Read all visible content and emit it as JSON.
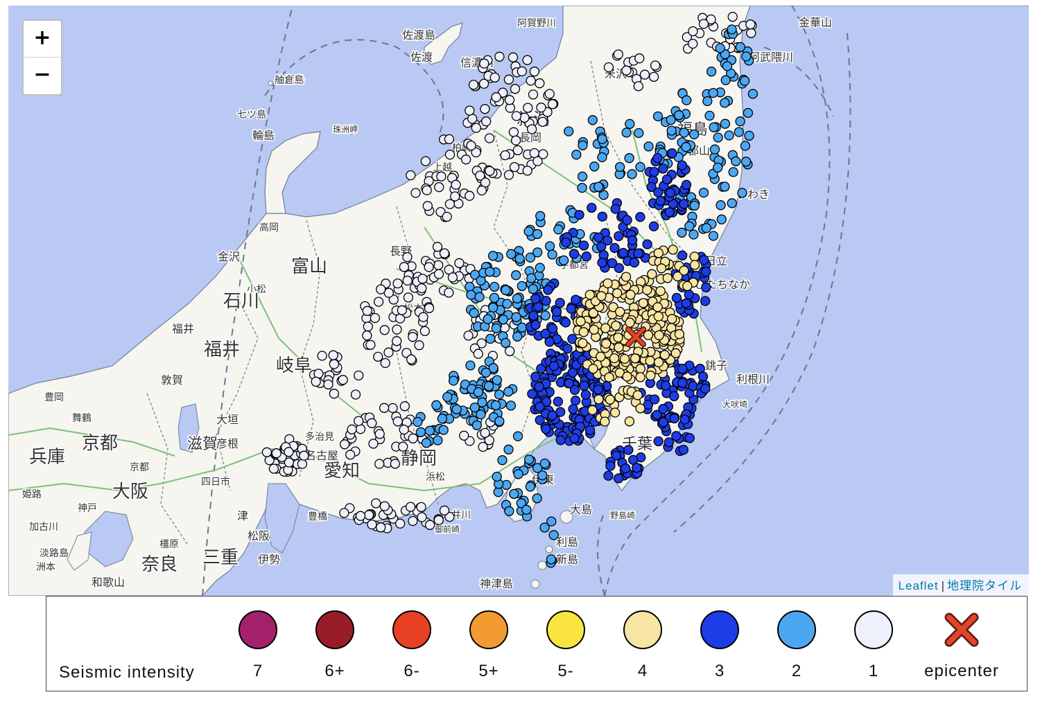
{
  "map": {
    "zoom_in_label": "+",
    "zoom_out_label": "−",
    "attribution": {
      "leaflet": "Leaflet",
      "separator": "|",
      "tiles": "地理院タイル"
    },
    "colors": {
      "sea": "#b9c9f3",
      "land": "#f6f5ef",
      "coast": "#6f7f9a",
      "border": "#8a8a8a",
      "road": "#7cc07c"
    },
    "place_labels": [
      {
        "text": "佐渡島",
        "size": 16
      },
      {
        "text": "佐渡",
        "size": 16
      },
      {
        "text": "粟島",
        "size": 14
      },
      {
        "text": "新潟",
        "size": 24
      },
      {
        "text": "長岡",
        "size": 16
      },
      {
        "text": "柏崎",
        "size": 14
      },
      {
        "text": "上越",
        "size": 14
      },
      {
        "text": "輪島",
        "size": 16
      },
      {
        "text": "舳倉島",
        "size": 14
      },
      {
        "text": "七ツ島",
        "size": 14
      },
      {
        "text": "珠洲岬",
        "size": 12
      },
      {
        "text": "高岡",
        "size": 14
      },
      {
        "text": "金沢",
        "size": 16
      },
      {
        "text": "富山",
        "size": 26
      },
      {
        "text": "小松",
        "size": 14
      },
      {
        "text": "石川",
        "size": 26
      },
      {
        "text": "福井",
        "size": 16
      },
      {
        "text": "福井",
        "size": 26
      },
      {
        "text": "岐阜",
        "size": 26
      },
      {
        "text": "敦賀",
        "size": 16
      },
      {
        "text": "豊岡",
        "size": 14
      },
      {
        "text": "舞鶴",
        "size": 14
      },
      {
        "text": "京都",
        "size": 26
      },
      {
        "text": "兵庫",
        "size": 26
      },
      {
        "text": "大阪",
        "size": 26
      },
      {
        "text": "奈良",
        "size": 26
      },
      {
        "text": "滋賀",
        "size": 22
      },
      {
        "text": "三重",
        "size": 26
      },
      {
        "text": "愛知",
        "size": 26
      },
      {
        "text": "静岡",
        "size": 26
      },
      {
        "text": "長野",
        "size": 16
      },
      {
        "text": "松本",
        "size": 14
      },
      {
        "text": "大垣",
        "size": 16
      },
      {
        "text": "彦根",
        "size": 16
      },
      {
        "text": "多治見",
        "size": 14
      },
      {
        "text": "名古屋",
        "size": 16
      },
      {
        "text": "四日市",
        "size": 14
      },
      {
        "text": "津",
        "size": 16
      },
      {
        "text": "松阪",
        "size": 16
      },
      {
        "text": "伊勢",
        "size": 16
      },
      {
        "text": "豊橋",
        "size": 14
      },
      {
        "text": "浜松",
        "size": 14
      },
      {
        "text": "伊東",
        "size": 16
      },
      {
        "text": "大島",
        "size": 16
      },
      {
        "text": "利島",
        "size": 16
      },
      {
        "text": "新島",
        "size": 16
      },
      {
        "text": "神津島",
        "size": 16
      },
      {
        "text": "御前崎",
        "size": 12
      },
      {
        "text": "横須賀",
        "size": 16
      },
      {
        "text": "千葉",
        "size": 22
      },
      {
        "text": "銚子",
        "size": 16
      },
      {
        "text": "日立",
        "size": 16
      },
      {
        "text": "ひたちなか",
        "size": 16
      },
      {
        "text": "いわき",
        "size": 16
      },
      {
        "text": "福島",
        "size": 22
      },
      {
        "text": "郡山",
        "size": 16
      },
      {
        "text": "米沢",
        "size": 16
      },
      {
        "text": "宇都宮",
        "size": 14
      },
      {
        "text": "金華山",
        "size": 16
      },
      {
        "text": "阿武隈川",
        "size": 16
      },
      {
        "text": "信濃川",
        "size": 16
      },
      {
        "text": "阿賀野川",
        "size": 14
      },
      {
        "text": "利根川",
        "size": 16
      },
      {
        "text": "大井川",
        "size": 14
      },
      {
        "text": "加古川",
        "size": 14
      },
      {
        "text": "神戸",
        "size": 14
      },
      {
        "text": "姫路",
        "size": 14
      },
      {
        "text": "和歌山",
        "size": 16
      },
      {
        "text": "淡路島",
        "size": 14
      },
      {
        "text": "洲本",
        "size": 14
      },
      {
        "text": "橿原",
        "size": 14
      },
      {
        "text": "京都",
        "size": 14
      },
      {
        "text": "野島崎",
        "size": 12
      },
      {
        "text": "大吠埼",
        "size": 12
      }
    ]
  },
  "legend": {
    "title": "Seismic intensity",
    "items": [
      {
        "label": "7",
        "color": "#a3206a"
      },
      {
        "label": "6+",
        "color": "#991d27"
      },
      {
        "label": "6-",
        "color": "#e84024"
      },
      {
        "label": "5+",
        "color": "#f29b30"
      },
      {
        "label": "5-",
        "color": "#fbe43f"
      },
      {
        "label": "4",
        "color": "#f8e5a4"
      },
      {
        "label": "3",
        "color": "#1e3de6"
      },
      {
        "label": "2",
        "color": "#4ca7f2"
      },
      {
        "label": "1",
        "color": "#eef0fb"
      }
    ],
    "epicenter": {
      "label": "epicenter",
      "color": "#e0452a"
    }
  }
}
